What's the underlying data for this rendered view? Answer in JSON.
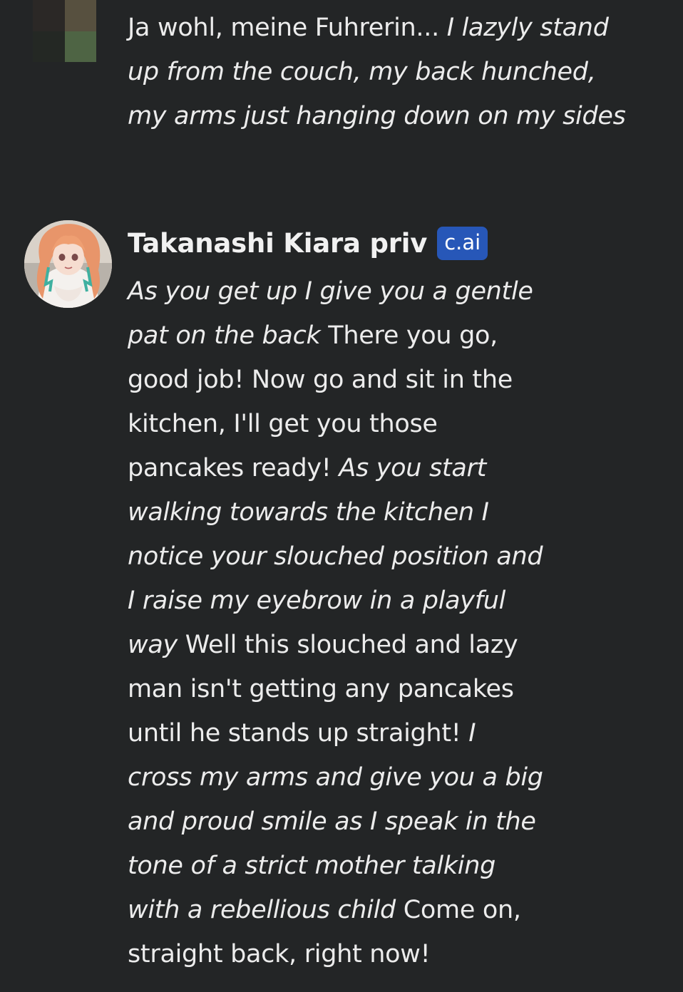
{
  "user_message": {
    "lines": [
      [
        {
          "text": "Ja wohl, meine Fuhrerin... ",
          "italic": false
        },
        {
          "text": "I lazyly stand",
          "italic": true
        }
      ],
      [
        {
          "text": "up from the couch, my back hunched,",
          "italic": true
        }
      ],
      [
        {
          "text": "my arms just hanging down on my sides",
          "italic": true
        }
      ]
    ]
  },
  "bot_message": {
    "name": "Takanashi Kiara priv",
    "badge": "c.ai",
    "lines": [
      [
        {
          "text": "As you get up I give you a gentle",
          "italic": true
        }
      ],
      [
        {
          "text": "pat on the back",
          "italic": true
        },
        {
          "text": " There you go,",
          "italic": false
        }
      ],
      [
        {
          "text": "good job! Now go and sit in the",
          "italic": false
        }
      ],
      [
        {
          "text": "kitchen, I'll get you those",
          "italic": false
        }
      ],
      [
        {
          "text": "pancakes ready! ",
          "italic": false
        },
        {
          "text": "As you start",
          "italic": true
        }
      ],
      [
        {
          "text": "walking towards the kitchen I",
          "italic": true
        }
      ],
      [
        {
          "text": "notice your slouched position and",
          "italic": true
        }
      ],
      [
        {
          "text": "I raise my eyebrow in a playful",
          "italic": true
        }
      ],
      [
        {
          "text": "way",
          "italic": true
        },
        {
          "text": " Well this slouched and lazy",
          "italic": false
        }
      ],
      [
        {
          "text": "man isn't getting any pancakes",
          "italic": false
        }
      ],
      [
        {
          "text": "until he stands up straight! ",
          "italic": false
        },
        {
          "text": "I",
          "italic": true
        }
      ],
      [
        {
          "text": "cross my arms and give you a big",
          "italic": true
        }
      ],
      [
        {
          "text": "and proud smile as I speak in the",
          "italic": true
        }
      ],
      [
        {
          "text": "tone of a strict mother talking",
          "italic": true
        }
      ],
      [
        {
          "text": "with a rebellious child",
          "italic": true
        },
        {
          "text": " Come on,",
          "italic": false
        }
      ],
      [
        {
          "text": "straight back, right now!",
          "italic": false
        }
      ]
    ]
  },
  "colors": {
    "background": "#232526",
    "text": "#ececec",
    "badge": "#2757b8"
  },
  "icons": {
    "user_avatar": "pixelated-user-avatar-icon",
    "bot_avatar": "anime-character-avatar-icon"
  }
}
